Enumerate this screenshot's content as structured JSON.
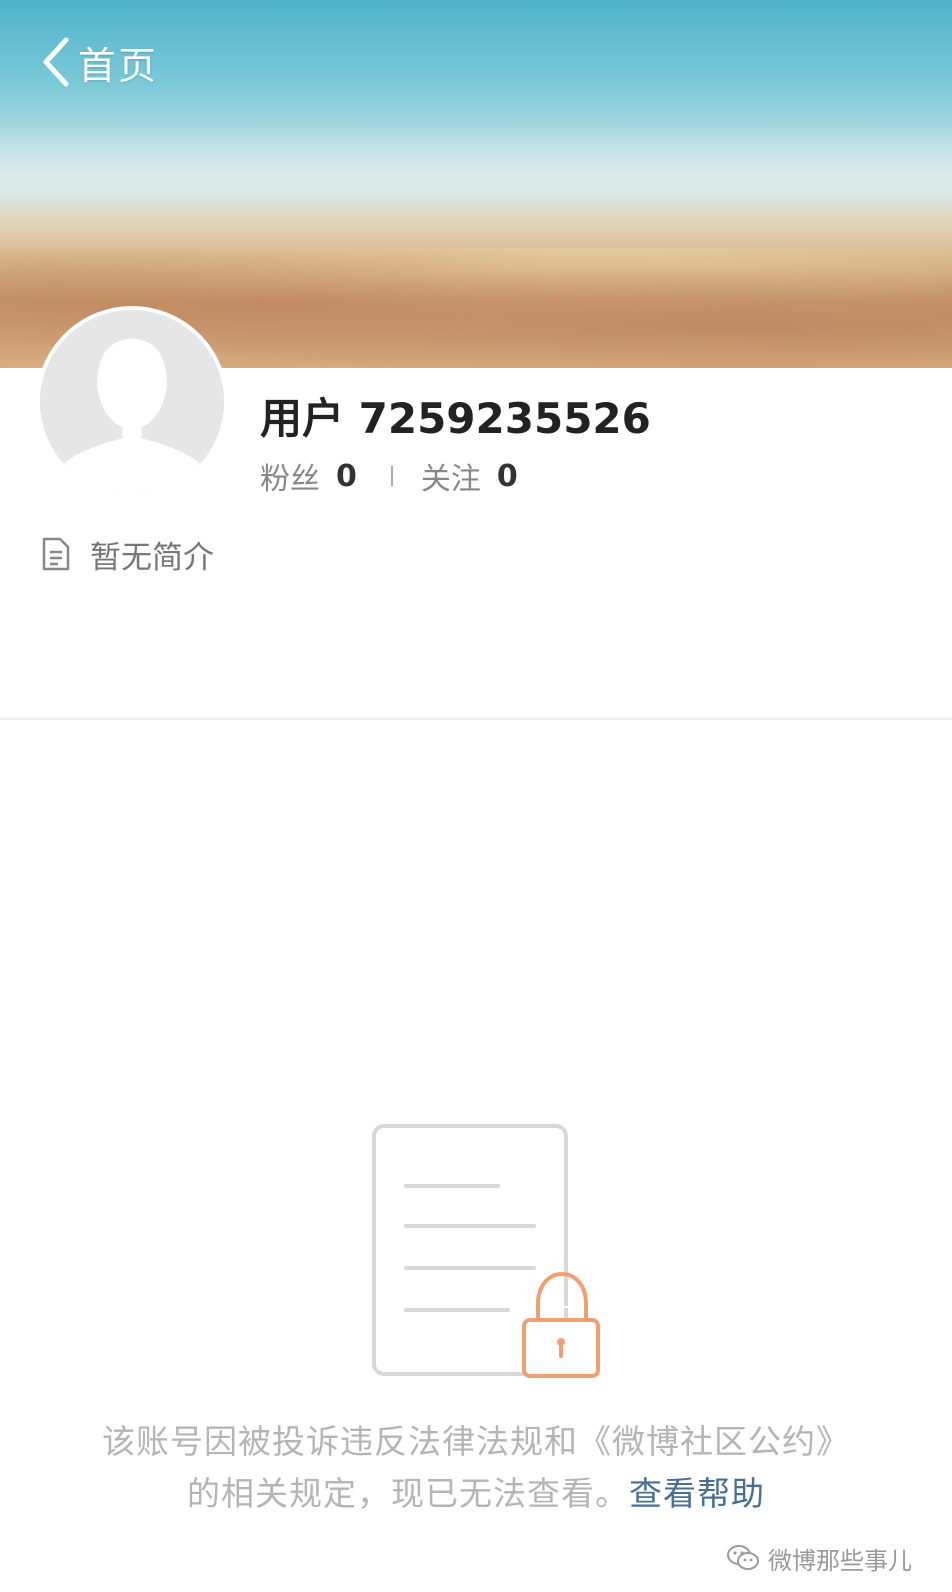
{
  "nav": {
    "back_label": "首页"
  },
  "profile": {
    "username": "用户 7259235526",
    "followers_label": "粉丝",
    "followers_count": "0",
    "following_label": "关注",
    "following_count": "0",
    "bio": "暂无简介"
  },
  "notice": {
    "message": "该账号因被投诉违反法律法规和《微博社区公约》的相关规定，现已无法查看。",
    "help_link": "查看帮助"
  },
  "watermark": {
    "text": "微博那些事儿"
  },
  "colors": {
    "link": "#4a6f93",
    "lock": "#f0a070",
    "muted_text": "#b5b5b5"
  },
  "icons": {
    "back": "chevron-left-icon",
    "bio": "document-icon",
    "illustration": "locked-document-icon",
    "watermark": "wechat-icon"
  }
}
